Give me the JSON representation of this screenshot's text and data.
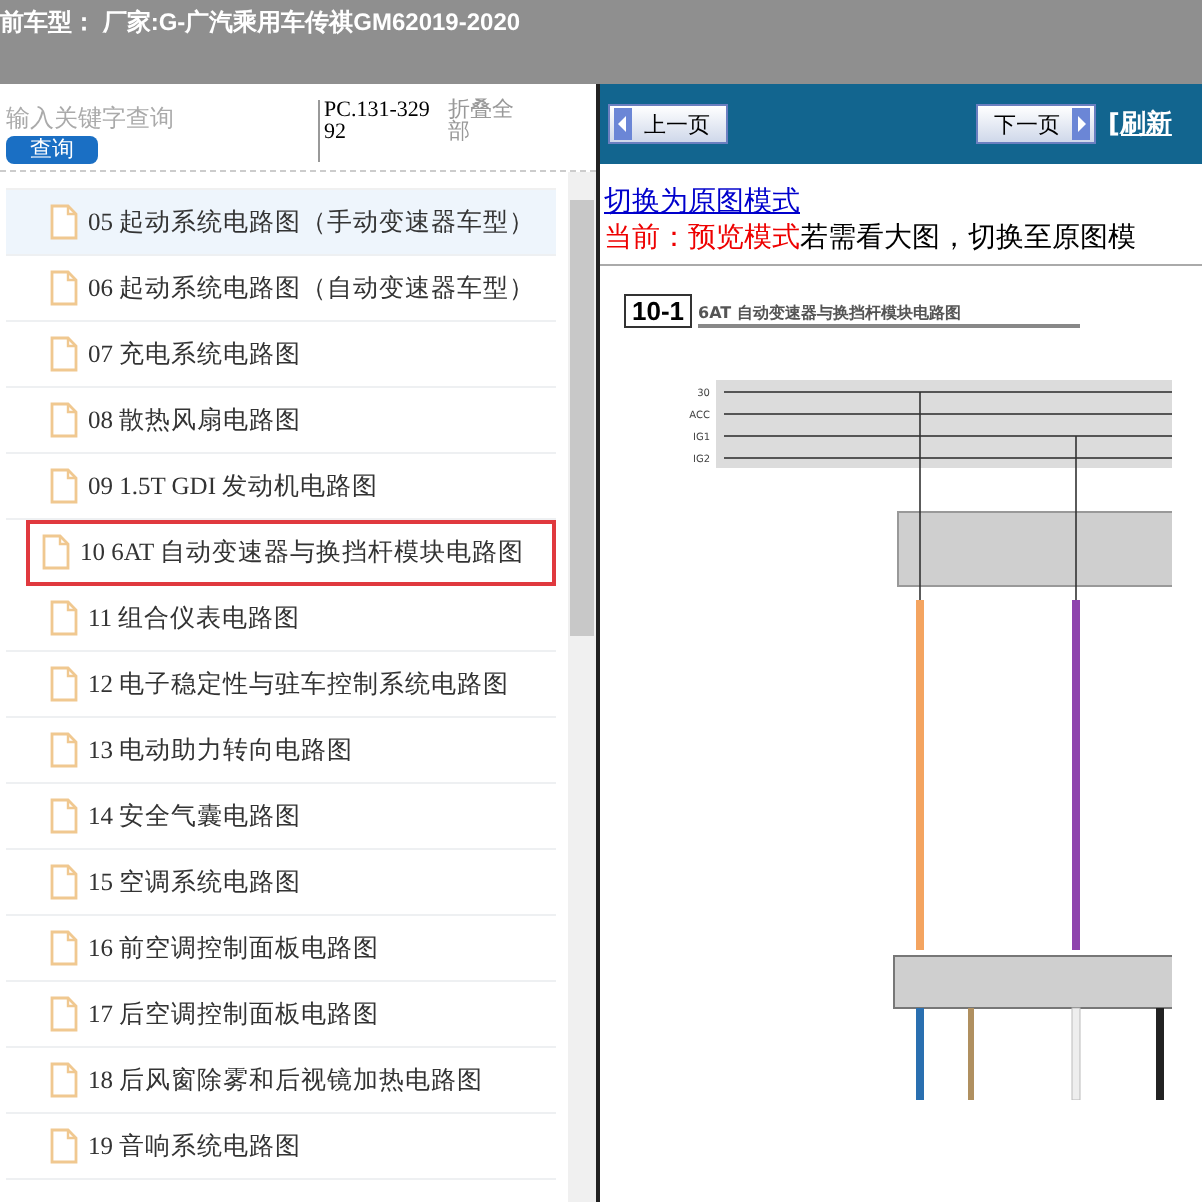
{
  "header": {
    "title": "前车型： 厂家:G-广汽乘用车传祺GM62019-2020"
  },
  "sidebar": {
    "search": {
      "placeholder": "输入关键字查询",
      "button": "查询"
    },
    "code": "PC.131-32992",
    "collapse": "折叠全部",
    "items": [
      {
        "label": "05 起动系统电路图（手动变速器车型）",
        "highlighted": true,
        "selected": false
      },
      {
        "label": "06 起动系统电路图（自动变速器车型）",
        "highlighted": false,
        "selected": false
      },
      {
        "label": "07 充电系统电路图",
        "highlighted": false,
        "selected": false
      },
      {
        "label": "08 散热风扇电路图",
        "highlighted": false,
        "selected": false
      },
      {
        "label": "09 1.5T GDI 发动机电路图",
        "highlighted": false,
        "selected": false
      },
      {
        "label": "10 6AT 自动变速器与换挡杆模块电路图",
        "highlighted": false,
        "selected": true
      },
      {
        "label": "11 组合仪表电路图",
        "highlighted": false,
        "selected": false
      },
      {
        "label": "12 电子稳定性与驻车控制系统电路图",
        "highlighted": false,
        "selected": false
      },
      {
        "label": "13 电动助力转向电路图",
        "highlighted": false,
        "selected": false
      },
      {
        "label": "14 安全气囊电路图",
        "highlighted": false,
        "selected": false
      },
      {
        "label": "15 空调系统电路图",
        "highlighted": false,
        "selected": false
      },
      {
        "label": "16 前空调控制面板电路图",
        "highlighted": false,
        "selected": false
      },
      {
        "label": "17 后空调控制面板电路图",
        "highlighted": false,
        "selected": false
      },
      {
        "label": "18 后风窗除雾和后视镜加热电路图",
        "highlighted": false,
        "selected": false
      },
      {
        "label": "19 音响系统电路图",
        "highlighted": false,
        "selected": false
      }
    ]
  },
  "viewer": {
    "prev": "上一页",
    "next": "下一页",
    "refresh": "[刷新",
    "switch_link": "切换为原图模式",
    "mode_label": "当前：预览模式",
    "mode_hint": "若需看大图，切换至原图模",
    "document": {
      "number": "10-1",
      "title": "6AT 自动变速器与换挡杆模块电路图",
      "bus_labels": [
        "30",
        "ACC",
        "IG1",
        "IG2"
      ]
    }
  }
}
